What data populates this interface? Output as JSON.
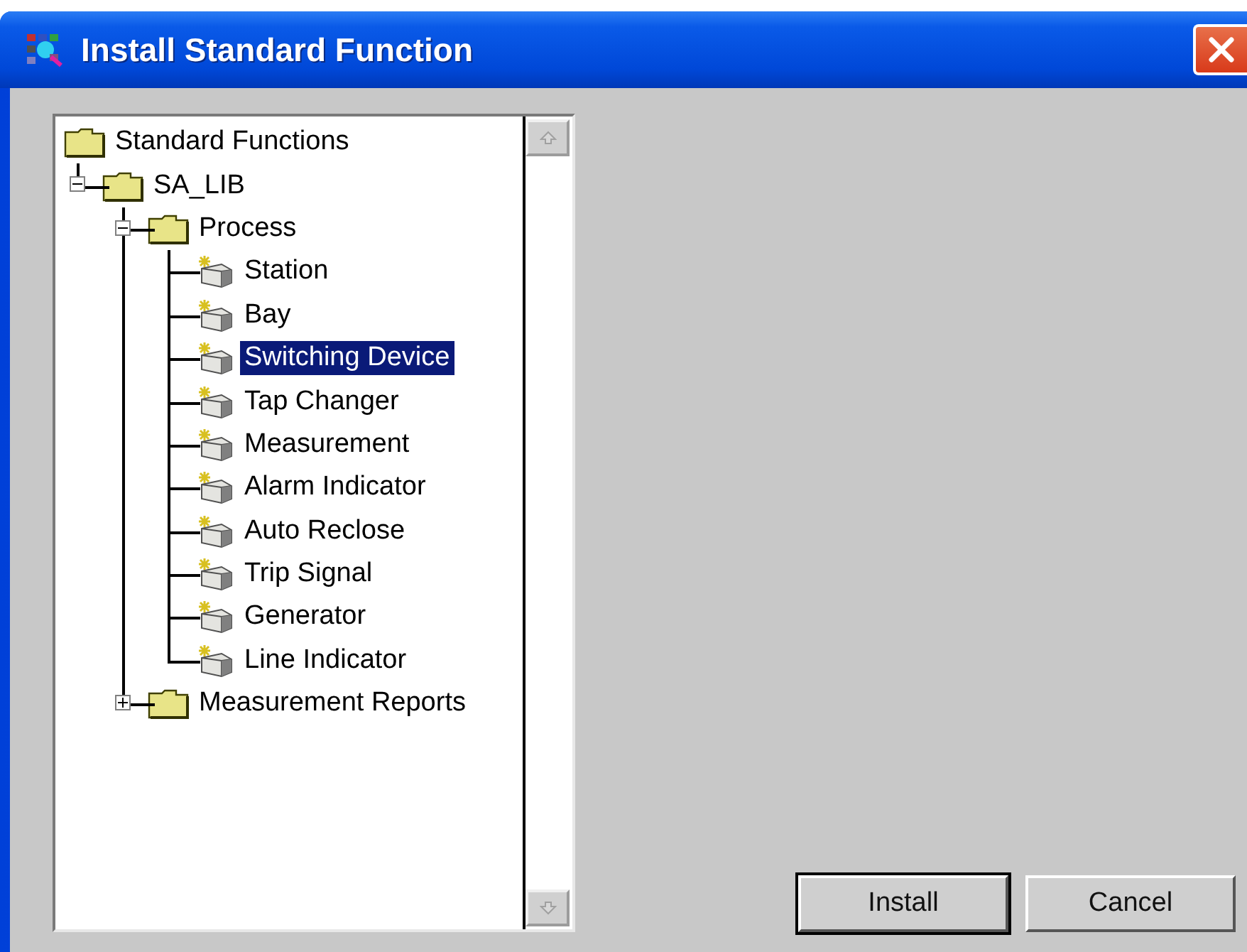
{
  "window": {
    "title": "Install Standard Function"
  },
  "tree": [
    {
      "label": "Standard Functions",
      "kind": "folder",
      "selected": false,
      "children": [
        {
          "label": "SA_LIB",
          "kind": "folder",
          "selected": false,
          "expanded": true,
          "children": [
            {
              "label": "Process",
              "kind": "folder",
              "selected": false,
              "expanded": true,
              "children": [
                {
                  "label": "Station",
                  "kind": "function",
                  "selected": false
                },
                {
                  "label": "Bay",
                  "kind": "function",
                  "selected": false
                },
                {
                  "label": "Switching Device",
                  "kind": "function",
                  "selected": true
                },
                {
                  "label": "Tap Changer",
                  "kind": "function",
                  "selected": false
                },
                {
                  "label": "Measurement",
                  "kind": "function",
                  "selected": false
                },
                {
                  "label": "Alarm Indicator",
                  "kind": "function",
                  "selected": false
                },
                {
                  "label": "Auto Reclose",
                  "kind": "function",
                  "selected": false
                },
                {
                  "label": "Trip Signal",
                  "kind": "function",
                  "selected": false
                },
                {
                  "label": "Generator",
                  "kind": "function",
                  "selected": false
                },
                {
                  "label": "Line Indicator",
                  "kind": "function",
                  "selected": false
                }
              ]
            },
            {
              "label": "Measurement Reports",
              "kind": "folder",
              "selected": false,
              "expanded": false
            }
          ]
        }
      ]
    }
  ],
  "buttons": [
    {
      "label": "Install",
      "default": true
    },
    {
      "label": "Cancel",
      "default": false
    }
  ]
}
